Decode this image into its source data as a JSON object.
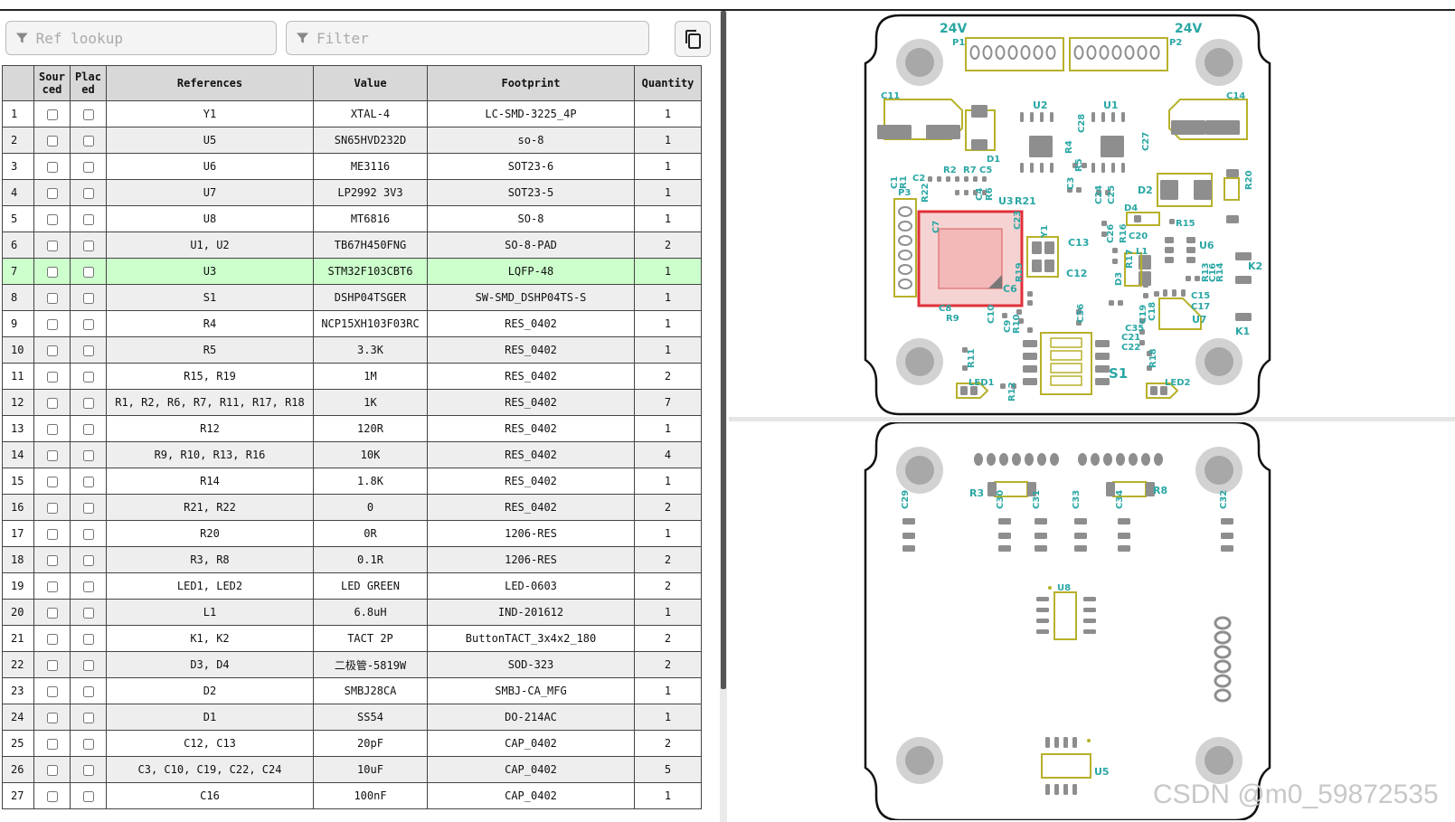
{
  "toolbar": {
    "ref_lookup_placeholder": "Ref lookup",
    "filter_placeholder": "Filter"
  },
  "table": {
    "headers": [
      "",
      "Sourced",
      "Placed",
      "References",
      "Value",
      "Footprint",
      "Quantity"
    ],
    "header_sourced_line1": "Sour",
    "header_sourced_line2": "ced",
    "header_placed_line1": "Plac",
    "header_placed_line2": "ed",
    "highlighted_row": 7,
    "rows": [
      {
        "num": "1",
        "refs": "Y1",
        "value": "XTAL-4",
        "footprint": "LC-SMD-3225_4P",
        "qty": "1"
      },
      {
        "num": "2",
        "refs": "U5",
        "value": "SN65HVD232D",
        "footprint": "so-8",
        "qty": "1"
      },
      {
        "num": "3",
        "refs": "U6",
        "value": "ME3116",
        "footprint": "SOT23-6",
        "qty": "1"
      },
      {
        "num": "4",
        "refs": "U7",
        "value": "LP2992 3V3",
        "footprint": "SOT23-5",
        "qty": "1"
      },
      {
        "num": "5",
        "refs": "U8",
        "value": "MT6816",
        "footprint": "SO-8",
        "qty": "1"
      },
      {
        "num": "6",
        "refs": "U1, U2",
        "value": "TB67H450FNG",
        "footprint": "SO-8-PAD",
        "qty": "2"
      },
      {
        "num": "7",
        "refs": "U3",
        "value": "STM32F103CBT6",
        "footprint": "LQFP-48",
        "qty": "1"
      },
      {
        "num": "8",
        "refs": "S1",
        "value": "DSHP04TSGER",
        "footprint": "SW-SMD_DSHP04TS-S",
        "qty": "1"
      },
      {
        "num": "9",
        "refs": "R4",
        "value": "NCP15XH103F03RC",
        "footprint": "RES_0402",
        "qty": "1"
      },
      {
        "num": "10",
        "refs": "R5",
        "value": "3.3K",
        "footprint": "RES_0402",
        "qty": "1"
      },
      {
        "num": "11",
        "refs": "R15, R19",
        "value": "1M",
        "footprint": "RES_0402",
        "qty": "2"
      },
      {
        "num": "12",
        "refs": "R1, R2, R6, R7, R11, R17, R18",
        "value": "1K",
        "footprint": "RES_0402",
        "qty": "7"
      },
      {
        "num": "13",
        "refs": "R12",
        "value": "120R",
        "footprint": "RES_0402",
        "qty": "1"
      },
      {
        "num": "14",
        "refs": "R9, R10, R13, R16",
        "value": "10K",
        "footprint": "RES_0402",
        "qty": "4"
      },
      {
        "num": "15",
        "refs": "R14",
        "value": "1.8K",
        "footprint": "RES_0402",
        "qty": "1"
      },
      {
        "num": "16",
        "refs": "R21, R22",
        "value": "0",
        "footprint": "RES_0402",
        "qty": "2"
      },
      {
        "num": "17",
        "refs": "R20",
        "value": "0R",
        "footprint": "1206-RES",
        "qty": "1"
      },
      {
        "num": "18",
        "refs": "R3, R8",
        "value": "0.1R",
        "footprint": "1206-RES",
        "qty": "2"
      },
      {
        "num": "19",
        "refs": "LED1, LED2",
        "value": "LED GREEN",
        "footprint": "LED-0603",
        "qty": "2"
      },
      {
        "num": "20",
        "refs": "L1",
        "value": "6.8uH",
        "footprint": "IND-201612",
        "qty": "1"
      },
      {
        "num": "21",
        "refs": "K1, K2",
        "value": "TACT 2P",
        "footprint": "ButtonTACT_3x4x2_180",
        "qty": "2"
      },
      {
        "num": "22",
        "refs": "D3, D4",
        "value": "二极管-5819W",
        "footprint": "SOD-323",
        "qty": "2"
      },
      {
        "num": "23",
        "refs": "D2",
        "value": "SMBJ28CA",
        "footprint": "SMBJ-CA_MFG",
        "qty": "1"
      },
      {
        "num": "24",
        "refs": "D1",
        "value": "SS54",
        "footprint": "DO-214AC",
        "qty": "1"
      },
      {
        "num": "25",
        "refs": "C12, C13",
        "value": "20pF",
        "footprint": "CAP_0402",
        "qty": "2"
      },
      {
        "num": "26",
        "refs": "C3, C10, C19, C22, C24",
        "value": "10uF",
        "footprint": "CAP_0402",
        "qty": "5"
      },
      {
        "num": "27",
        "refs": "C16",
        "value": "100nF",
        "footprint": "CAP_0402",
        "qty": "1"
      }
    ]
  },
  "pcb_front": {
    "labels": {
      "v24_left": "24V",
      "v24_right": "24V",
      "p1": "P1",
      "p2": "P2",
      "c11": "C11",
      "c14": "C14",
      "u2": "U2",
      "u1": "U1",
      "c28": "C28",
      "c27": "C27",
      "r4": "R4",
      "r5": "R5",
      "c3": "C3",
      "d1": "D1",
      "r2": "R2",
      "r7": "R7",
      "c5": "C5",
      "c2": "C2",
      "c1": "C1",
      "r1": "R1",
      "p3": "P3",
      "r22": "R22",
      "c4": "C4",
      "r6": "R6",
      "u3": "U3",
      "r21": "R21",
      "c23": "C23",
      "c24": "C24",
      "c25": "C25",
      "d2": "D2",
      "r20": "R20",
      "d4": "D4",
      "r15": "R15",
      "c26": "C26",
      "r16": "R16",
      "c20": "C20",
      "l1": "L1",
      "u6": "U6",
      "y1": "Y1",
      "c13": "C13",
      "c12": "C12",
      "r19": "R19",
      "d3": "D3",
      "r17": "R17",
      "k2": "K2",
      "c15": "C15",
      "c17": "C17",
      "c6": "C6",
      "c8": "C8",
      "r9": "R9",
      "c10": "C10",
      "c9": "C9",
      "r10": "R10",
      "c36": "C36",
      "c35": "C35",
      "c21": "C21",
      "c22": "C22",
      "c19": "C19",
      "c18": "C18",
      "u7": "U7",
      "k1": "K1",
      "r11": "R11",
      "r12": "R12",
      "r18": "R18",
      "s1": "S1",
      "led1": "LED1",
      "led2": "LED2",
      "c7": "C7",
      "r13": "R13",
      "c16": "C16",
      "r14": "R14"
    }
  },
  "pcb_back": {
    "labels": {
      "r3": "R3",
      "r8": "R8",
      "c29": "C29",
      "c30": "C30",
      "c31": "C31",
      "c33": "C33",
      "c34": "C34",
      "c32": "C32",
      "u8": "U8",
      "u5": "U5"
    }
  },
  "watermark": "CSDN @m0_59872535",
  "colors": {
    "header_bg": "#d8d8d8",
    "row_alt": "#eeeeee",
    "row_highlight": "#ccffcc",
    "silk_text": "#2aa7a5",
    "silk_outline": "#b7b12a",
    "highlight_part": "#e0303a",
    "pad": "#8e8e8e"
  }
}
